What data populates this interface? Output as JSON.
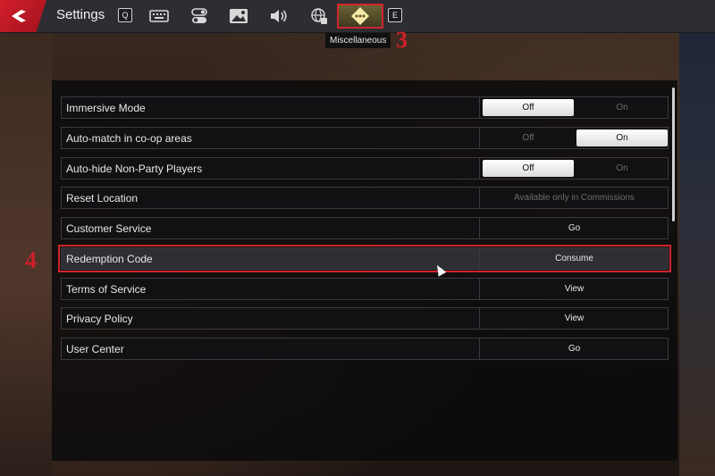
{
  "header": {
    "title": "Settings",
    "prev_key": "Q",
    "next_key": "E",
    "tabs": [
      {
        "icon": "keyboard-icon"
      },
      {
        "icon": "toggle-icon"
      },
      {
        "icon": "image-icon"
      },
      {
        "icon": "speaker-icon"
      },
      {
        "icon": "globe-icon"
      },
      {
        "icon": "diamond-dots-icon",
        "active": true
      }
    ],
    "tooltip": "Miscellaneous"
  },
  "annotations": {
    "step_tab": "3",
    "step_row": "4"
  },
  "settings": [
    {
      "label": "Immersive Mode",
      "type": "toggle",
      "off": "Off",
      "on": "On",
      "value": "Off"
    },
    {
      "label": "Auto-match in co-op areas",
      "type": "toggle",
      "off": "Off",
      "on": "On",
      "value": "On"
    },
    {
      "label": "Auto-hide Non-Party Players",
      "type": "toggle",
      "off": "Off",
      "on": "On",
      "value": "Off"
    },
    {
      "label": "Reset Location",
      "type": "button",
      "action": "Available only in Commissions",
      "disabled": true
    },
    {
      "label": "Customer Service",
      "type": "button",
      "action": "Go"
    },
    {
      "label": "Redemption Code",
      "type": "button",
      "action": "Consume",
      "highlighted": true
    },
    {
      "label": "Terms of Service",
      "type": "button",
      "action": "View"
    },
    {
      "label": "Privacy Policy",
      "type": "button",
      "action": "View"
    },
    {
      "label": "User Center",
      "type": "button",
      "action": "Go"
    }
  ],
  "colors": {
    "accent_red": "#d0242e",
    "panel_bg": "#111114",
    "active_toggle": "#ffffff"
  }
}
